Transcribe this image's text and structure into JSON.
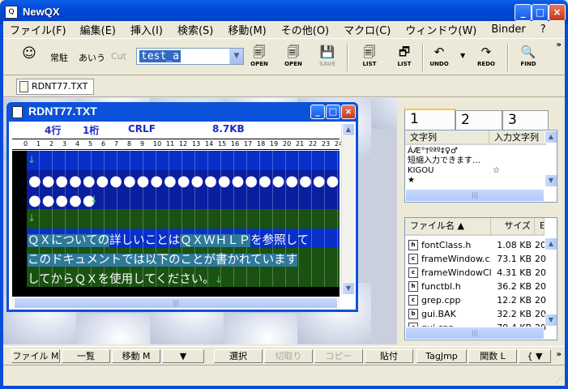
{
  "window": {
    "title": "NewQX",
    "min_label": "_",
    "max_label": "□",
    "close_label": "×"
  },
  "menu": [
    "ファイル(F)",
    "編集(E)",
    "挿入(I)",
    "検索(S)",
    "移動(M)",
    "その他(O)",
    "マクロ(C)",
    "ウィンドウ(W)",
    "Binder",
    "?"
  ],
  "toolbar": {
    "mode_labels": [
      "常駐",
      "あいう",
      "Cut"
    ],
    "combo_value": "test_a",
    "buttons": [
      "OPEN",
      "OPEN",
      "SAVE",
      "LIST",
      "LIST",
      "UNDO",
      "REDO",
      "FIND"
    ]
  },
  "doc_tab": "RDNT77.TXT",
  "child": {
    "title": "RDNT77.TXT",
    "status": {
      "line": "4行",
      "column": "1桁",
      "eol": "CRLF",
      "size": "8.7KB"
    },
    "ruler": [
      "0",
      "1",
      "2",
      "3",
      "4",
      "5",
      "6",
      "7",
      "8",
      "9",
      "10",
      "11",
      "12",
      "13",
      "14",
      "15",
      "16",
      "17",
      "18",
      "19",
      "20",
      "21",
      "22",
      "23",
      "24"
    ],
    "lines": {
      "circles_full": "●●●●●●●●●●●●●●●●●●●●●●●●●●",
      "circles_short": "●●●●●",
      "text1_a": "ＱＸについての",
      "text1_b": "詳しいことは",
      "text1_c": "ＱＸＷＨＬＰ",
      "text1_d": "を参照して",
      "text2_a": "このドキュメント",
      "text2_b": "では以下のことが書かれています",
      "text3": "してからＱＸを使用してください。"
    }
  },
  "subst_panel": {
    "tabs": [
      "1",
      "2",
      "3"
    ],
    "headers": [
      "文字列",
      "入力文字列"
    ],
    "rows": [
      {
        "left": "ÁÆ°†ºªº‡♀♂",
        "right": ""
      },
      {
        "left": "短縮入力できます…",
        "right": ""
      },
      {
        "left": "KIGOU",
        "right": "☆"
      },
      {
        "left": "★",
        "right": ""
      }
    ]
  },
  "file_panel": {
    "headers": [
      "ファイル名 ▲",
      "サイズ",
      "E"
    ],
    "files": [
      {
        "icon": "h",
        "name": "fontClass.h",
        "size": "1.08 KB",
        "date": "20"
      },
      {
        "icon": "c",
        "name": "frameWindow.c...",
        "size": "73.1 KB",
        "date": "20"
      },
      {
        "icon": "c",
        "name": "frameWindowCl...",
        "size": "4.31 KB",
        "date": "20"
      },
      {
        "icon": "h",
        "name": "functbl.h",
        "size": "36.2 KB",
        "date": "20"
      },
      {
        "icon": "c",
        "name": "grep.cpp",
        "size": "12.2 KB",
        "date": "20"
      },
      {
        "icon": "b",
        "name": "gui.BAK",
        "size": "32.2 KB",
        "date": "20"
      },
      {
        "icon": "c",
        "name": "gui.cpp",
        "size": "79.4 KB",
        "date": "20"
      }
    ]
  },
  "fkeys": [
    "ファイル M",
    "一覧",
    "移動 M",
    "▼",
    "選択",
    "切取り",
    "コピー",
    "貼付",
    "TagJmp",
    "関数 L",
    "{ ▼"
  ]
}
